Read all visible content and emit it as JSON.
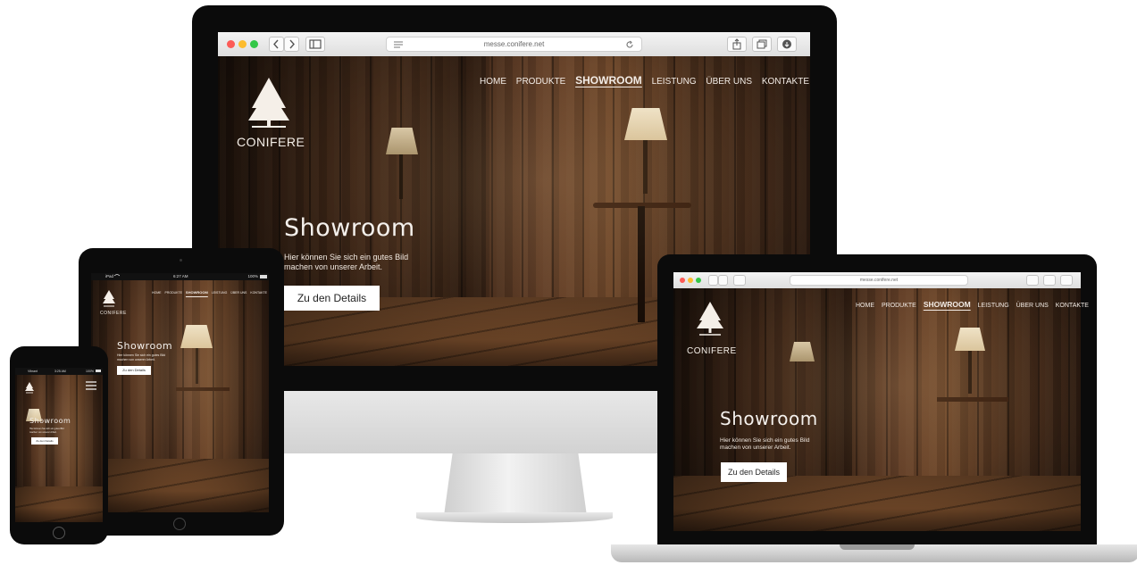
{
  "site": {
    "url": "messe.conifere.net",
    "logo_text": "CONIFERE",
    "nav": [
      "HOME",
      "PRODUKTE",
      "SHOWROOM",
      "LEISTUNG",
      "ÜBER UNS",
      "KONTAKTE"
    ],
    "active_nav": "SHOWROOM",
    "hero_title": "Showroom",
    "hero_subtitle_line1": "Hier können Sie sich ein gutes Bild",
    "hero_subtitle_line2": "machen von unserer Arbeit.",
    "cta_label": "Zu den Details"
  },
  "tablet": {
    "status_left": "iPad",
    "status_time": "6:27 AM",
    "status_battery": "100%"
  },
  "phone": {
    "status_carrier": "Vibrant",
    "status_time": "3:25 AM",
    "status_battery": "100%"
  },
  "colors": {
    "traffic_red": "#fc5b57",
    "traffic_yellow": "#fdbc2e",
    "traffic_green": "#33c748",
    "device_black": "#0b0b0b",
    "silver": "#dcdcdc"
  },
  "icons": [
    "back-icon",
    "forward-icon",
    "sidebar-icon",
    "reader-icon",
    "reload-icon",
    "share-icon",
    "tabs-icon",
    "download-icon",
    "pine-cone-logo-icon",
    "hamburger-menu-icon",
    "wifi-icon",
    "battery-icon",
    "camera-icon",
    "home-button-icon"
  ]
}
